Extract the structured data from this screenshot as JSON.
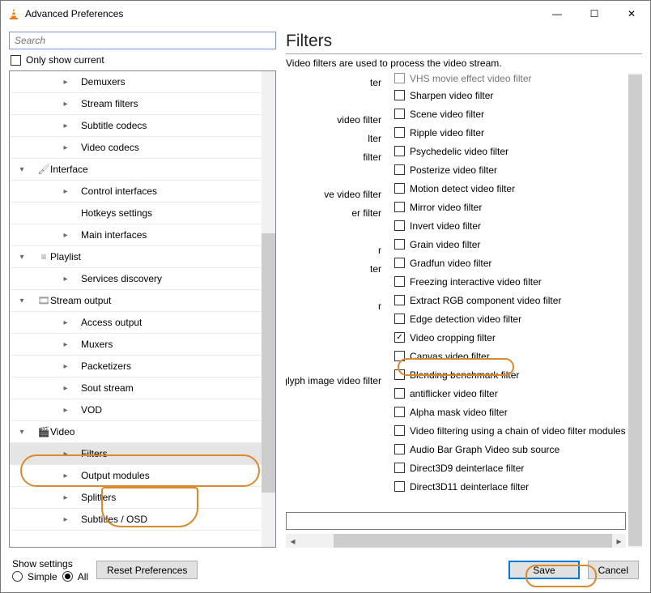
{
  "titlebar": {
    "title": "Advanced Preferences"
  },
  "winbtns": {
    "min": "—",
    "max": "☐",
    "close": "✕"
  },
  "search": {
    "placeholder": "Search"
  },
  "only_show": {
    "label": "Only show current"
  },
  "tree": [
    {
      "level": 2,
      "chev": ">",
      "label": "Demuxers"
    },
    {
      "level": 2,
      "chev": ">",
      "label": "Stream filters"
    },
    {
      "level": 2,
      "chev": ">",
      "label": "Subtitle codecs"
    },
    {
      "level": 2,
      "chev": ">",
      "label": "Video codecs"
    },
    {
      "level": 0,
      "chev": "v",
      "icon": "brush",
      "label": "Interface"
    },
    {
      "level": 2,
      "chev": ">",
      "label": "Control interfaces"
    },
    {
      "level": 2,
      "chev": "",
      "label": "Hotkeys settings"
    },
    {
      "level": 2,
      "chev": ">",
      "label": "Main interfaces"
    },
    {
      "level": 0,
      "chev": "v",
      "icon": "list",
      "label": "Playlist"
    },
    {
      "level": 2,
      "chev": ">",
      "label": "Services discovery"
    },
    {
      "level": 0,
      "chev": "v",
      "icon": "film",
      "label": "Stream output"
    },
    {
      "level": 2,
      "chev": ">",
      "label": "Access output"
    },
    {
      "level": 2,
      "chev": ">",
      "label": "Muxers"
    },
    {
      "level": 2,
      "chev": ">",
      "label": "Packetizers"
    },
    {
      "level": 2,
      "chev": ">",
      "label": "Sout stream"
    },
    {
      "level": 2,
      "chev": ">",
      "label": "VOD"
    },
    {
      "level": 0,
      "chev": "v",
      "icon": "video",
      "label": "Video"
    },
    {
      "level": 2,
      "chev": ">",
      "label": "Filters",
      "selected": true
    },
    {
      "level": 2,
      "chev": ">",
      "label": "Output modules"
    },
    {
      "level": 2,
      "chev": ">",
      "label": "Splitters"
    },
    {
      "level": 2,
      "chev": ">",
      "label": "Subtitles / OSD"
    }
  ],
  "right": {
    "heading": "Filters",
    "desc": "Video filters are used to process the video stream."
  },
  "left_labels": [
    "ter",
    "",
    "video filter",
    "lter",
    "filter",
    "",
    "ve video filter",
    "er filter",
    "",
    "r",
    "ter",
    "",
    "r",
    "",
    "",
    "",
    "naglyph image video filter"
  ],
  "checks": [
    {
      "label": "VHS movie effect video filter",
      "checked": false,
      "faded": true
    },
    {
      "label": "Sharpen video filter",
      "checked": false
    },
    {
      "label": "Scene video filter",
      "checked": false
    },
    {
      "label": "Ripple video filter",
      "checked": false
    },
    {
      "label": "Psychedelic video filter",
      "checked": false
    },
    {
      "label": "Posterize video filter",
      "checked": false
    },
    {
      "label": "Motion detect video filter",
      "checked": false
    },
    {
      "label": "Mirror video filter",
      "checked": false
    },
    {
      "label": "Invert video filter",
      "checked": false
    },
    {
      "label": "Grain video filter",
      "checked": false
    },
    {
      "label": "Gradfun video filter",
      "checked": false
    },
    {
      "label": "Freezing interactive video filter",
      "checked": false
    },
    {
      "label": "Extract RGB component video filter",
      "checked": false
    },
    {
      "label": "Edge detection video filter",
      "checked": false
    },
    {
      "label": "Video cropping filter",
      "checked": true
    },
    {
      "label": "Canvas video filter",
      "checked": false
    },
    {
      "label": "Blending benchmark filter",
      "checked": false
    },
    {
      "label": "antiflicker video filter",
      "checked": false
    },
    {
      "label": "Alpha mask video filter",
      "checked": false
    },
    {
      "label": "Video filtering using a chain of video filter modules",
      "checked": false
    },
    {
      "label": "Audio Bar Graph Video sub source",
      "checked": false
    },
    {
      "label": "Direct3D9 deinterlace filter",
      "checked": false
    },
    {
      "label": "Direct3D11 deinterlace filter",
      "checked": false
    }
  ],
  "bottom": {
    "show_settings": "Show settings",
    "simple": "Simple",
    "all": "All",
    "reset": "Reset Preferences",
    "save": "Save",
    "cancel": "Cancel"
  }
}
